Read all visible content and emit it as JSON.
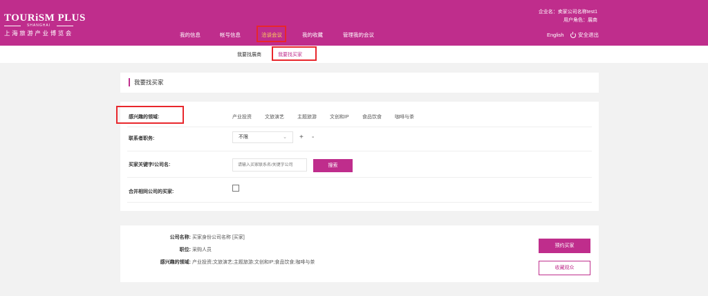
{
  "brand": {
    "name": "TOURiSM PLUS",
    "city": "SHANGHAI",
    "cn": "上海旅游产业博览会"
  },
  "nav": {
    "items": [
      "我的信息",
      "帐号信息",
      "洽谈会议",
      "我的收藏",
      "管理我的会议"
    ],
    "active_index": 2
  },
  "user": {
    "company": "企业名：卖家公司名称test1",
    "role": "用户角色：展商"
  },
  "header": {
    "lang": "English",
    "logout": "安全退出"
  },
  "subnav": {
    "items": [
      "我要找展商",
      "我要找买家"
    ],
    "active_index": 1
  },
  "page": {
    "title": "我要找买家"
  },
  "filter": {
    "interest_label": "感兴趣的领域:",
    "interests": [
      "产业投资",
      "文旅演艺",
      "主题旅游",
      "文创和IP",
      "食品饮食",
      "咖啡与茶"
    ],
    "position_label": "联系者职务:",
    "position_value": "不限",
    "plus": "+",
    "minus": "-",
    "keyword_label": "买家关键字/公司名:",
    "keyword_placeholder": "请输入买家联系名/关键字公司",
    "search_label": "搜索",
    "merge_label": "合并相同公司的买家:"
  },
  "result": {
    "company_label": "公司名称:",
    "company_value": "买家身份公司名称 [买家]",
    "position_label": "职位:",
    "position_value": "采购人员",
    "interest_label": "感兴趣的领域:",
    "interest_value": "产业投资;文旅演艺;主题旅游;文创和IP;食品饮食;咖啡与茶",
    "book_label": "预约买家",
    "favorite_label": "收藏观众"
  },
  "colors": {
    "brand": "#bf2d8c",
    "highlight": "#e8262b",
    "nav_active": "#ffd75a"
  },
  "icons": [
    "power-icon",
    "chevron-down-icon"
  ]
}
